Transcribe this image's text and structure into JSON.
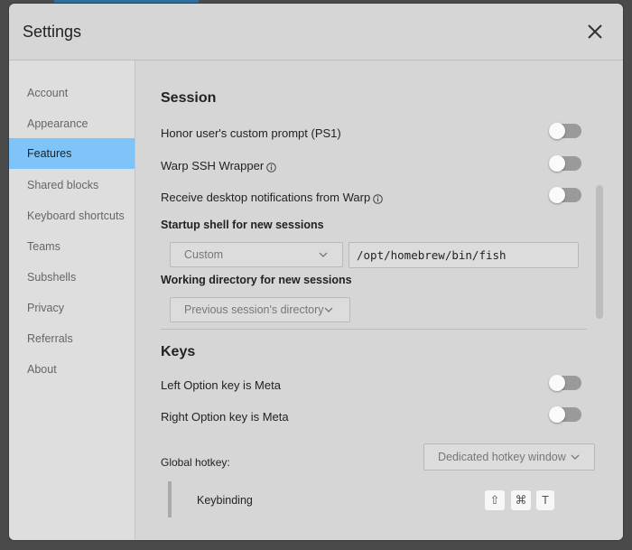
{
  "dialog": {
    "title": "Settings"
  },
  "sidebar": {
    "items": [
      {
        "label": "Account"
      },
      {
        "label": "Appearance"
      },
      {
        "label": "Features",
        "active": true
      },
      {
        "label": "Shared blocks"
      },
      {
        "label": "Keyboard shortcuts"
      },
      {
        "label": "Teams"
      },
      {
        "label": "Subshells"
      },
      {
        "label": "Privacy"
      },
      {
        "label": "Referrals"
      },
      {
        "label": "About"
      }
    ]
  },
  "session": {
    "title": "Session",
    "honor_prompt": {
      "label": "Honor user's custom prompt (PS1)",
      "enabled": false
    },
    "ssh_wrapper": {
      "label": "Warp SSH Wrapper",
      "enabled": false
    },
    "notifications": {
      "label": "Receive desktop notifications from Warp",
      "enabled": false
    },
    "startup_shell": {
      "label": "Startup shell for new sessions",
      "selected": "Custom",
      "path": "/opt/homebrew/bin/fish"
    },
    "working_dir": {
      "label": "Working directory for new sessions",
      "selected": "Previous session's directory"
    }
  },
  "keys": {
    "title": "Keys",
    "left_option": {
      "label": "Left Option key is Meta",
      "enabled": false
    },
    "right_option": {
      "label": "Right Option key is Meta",
      "enabled": false
    },
    "global_hotkey": {
      "label": "Global hotkey:",
      "selected": "Dedicated hotkey window"
    },
    "keybinding": {
      "label": "Keybinding",
      "keys": [
        "⇧",
        "⌘",
        "T"
      ]
    }
  },
  "colors": {
    "accent": "#7ec4f8",
    "toggle_off": "#9a9a9a",
    "panel": "#d6d6d6"
  }
}
